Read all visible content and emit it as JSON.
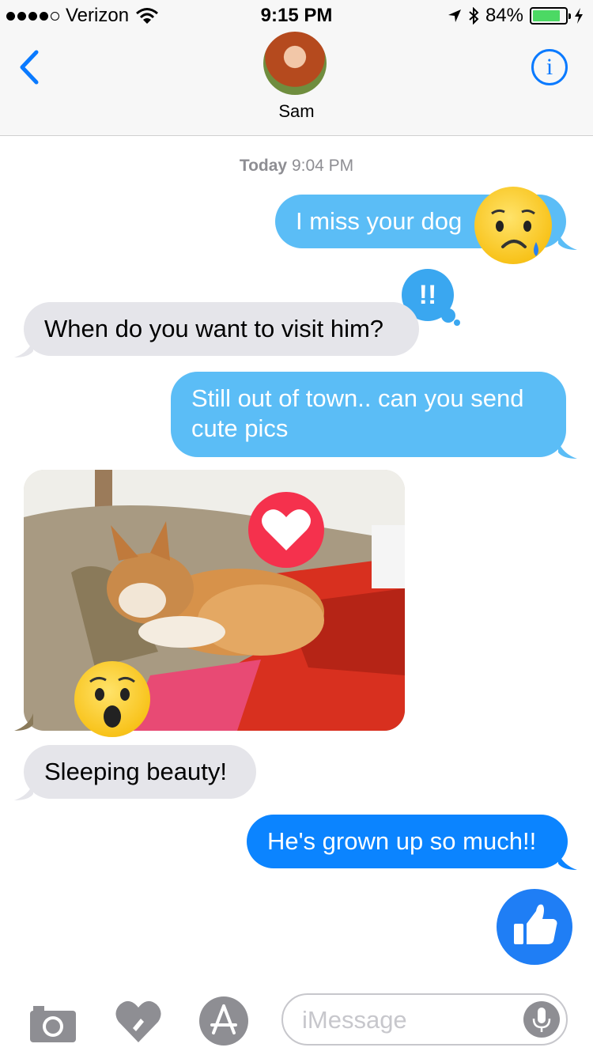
{
  "status_bar": {
    "carrier": "Verizon",
    "time": "9:15 PM",
    "battery": "84%"
  },
  "header": {
    "contact_name": "Sam",
    "info_label": "i"
  },
  "conversation": {
    "timestamp_day": "Today",
    "timestamp_time": "9:04 PM",
    "messages": [
      {
        "side": "sent",
        "text": "I miss your dog"
      },
      {
        "side": "received",
        "text": "When do you want to visit him?"
      },
      {
        "side": "sent",
        "text": "Still out of town.. can you send cute pics"
      },
      {
        "side": "received",
        "text": "Sleeping beauty!"
      },
      {
        "side": "sent",
        "text": "He's grown up so much!!"
      }
    ],
    "reactions": {
      "exclamation": "!!"
    }
  },
  "input_bar": {
    "placeholder": "iMessage"
  },
  "colors": {
    "accent": "#0a7aff",
    "sent_light": "#5bbdf6",
    "sent_blue": "#0b84ff",
    "received": "#e5e5ea",
    "heart": "#f5314d",
    "thumbs": "#1f7ef5",
    "battery": "#4cd964"
  },
  "icons": [
    "location-arrow-icon",
    "bluetooth-icon",
    "battery-icon",
    "charging-icon",
    "wifi-icon",
    "back-chevron-icon",
    "info-icon",
    "heart-icon",
    "thumbs-up-icon",
    "camera-icon",
    "digital-touch-icon",
    "app-store-icon",
    "microphone-icon"
  ]
}
